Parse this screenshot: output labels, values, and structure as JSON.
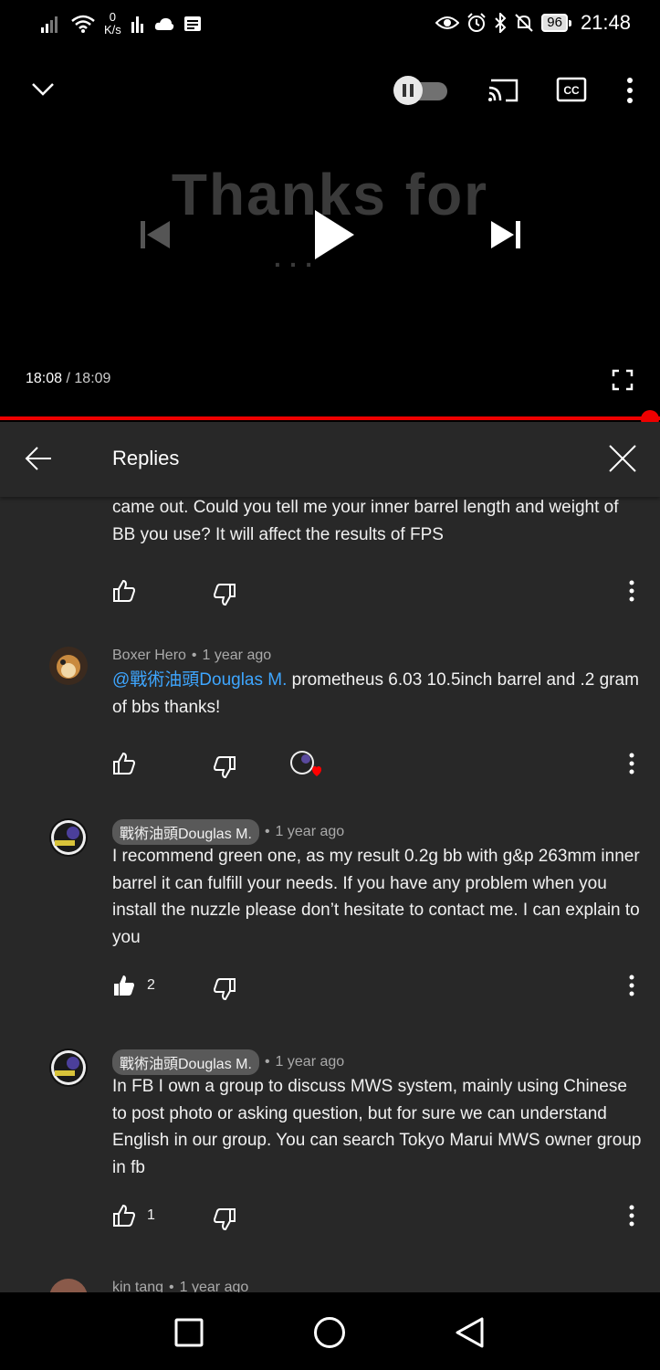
{
  "status_bar": {
    "speed_value": "0",
    "speed_unit": "K/s",
    "battery": "96",
    "clock": "21:48"
  },
  "player": {
    "overlay_text": "Thanks for",
    "current_time": "18:08",
    "separator": " / ",
    "duration": "18:09",
    "progress_percent": 99.9
  },
  "panel": {
    "title": "Replies"
  },
  "comments": [
    {
      "body": "came out. Could you tell me your inner barrel length and weight of BB you use? It will affect the results of FPS"
    },
    {
      "author": "Boxer Hero",
      "age": "1 year ago",
      "mention": "@戰術油頭Douglas M.",
      "body": " prometheus 6.03 10.5inch  barrel and .2 gram of bbs thanks!"
    },
    {
      "author": "戰術油頭Douglas M.",
      "age": "1 year ago",
      "body": "I recommend green one, as my result 0.2g bb with g&p 263mm inner barrel it can fulfill your needs. If you have any problem when you install the nuzzle please don’t hesitate to contact me. I can explain to you",
      "likes": "2"
    },
    {
      "author": "戰術油頭Douglas M.",
      "age": "1 year ago",
      "body": "In FB I own a group to discuss MWS system, mainly using Chinese to post photo or asking question, but for sure we can understand English in our group. You can search Tokyo Marui MWS owner group in fb",
      "likes": "1"
    },
    {
      "author": "kin tang",
      "age": "1 year ago"
    }
  ],
  "meta_separator": "•",
  "colors": {
    "background": "#000000",
    "panel": "#282828",
    "progress": "#ee0000",
    "mention": "#3ea6ff",
    "heart": "#ff0000"
  }
}
